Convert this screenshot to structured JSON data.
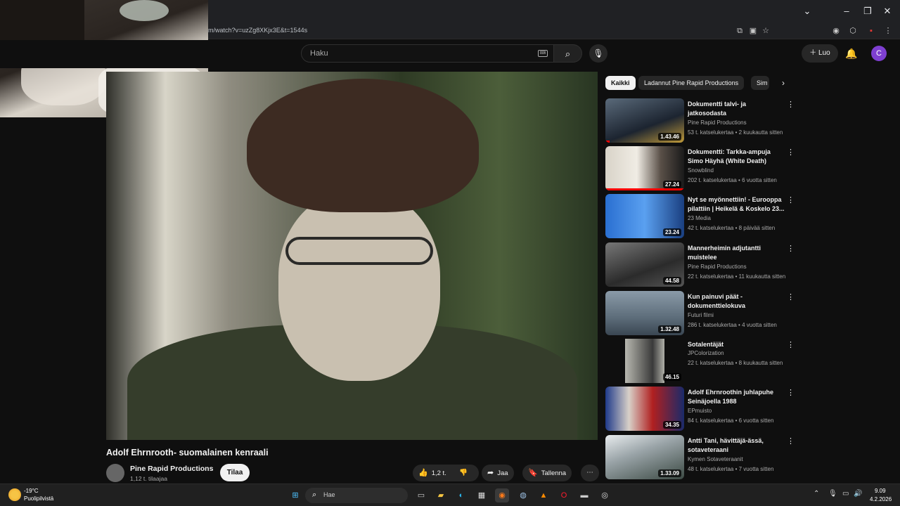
{
  "browser": {
    "url": "m/watch?v=uzZg8XKjx3E&t=1544s",
    "window_controls": [
      "chevron-down-icon",
      "minimize-icon",
      "restore-icon",
      "close-icon"
    ]
  },
  "header": {
    "search_placeholder": "Haku",
    "create_label": "Luo",
    "avatar_initial": "C",
    "accent_color": "#7e3fd1"
  },
  "video": {
    "title": "Adolf Ehrnrooth- suomalainen kenraali",
    "channel": "Pine Rapid Productions",
    "subscribers": "1,12 t. tilaajaa",
    "subscribe_label": "Tilaa",
    "likes": "1,2 t.",
    "share_label": "Jaa",
    "save_label": "Tallenna"
  },
  "chips": [
    "Kaikki",
    "Ladannut Pine Rapid Productions",
    "Sim"
  ],
  "recommendations": [
    {
      "title": "Dokumentti talvi- ja jatkosodasta",
      "channel": "Pine Rapid Productions",
      "meta": "53 t. katselukertaa • 2 kuukautta sitten",
      "duration": "1.43.46",
      "progress": 0.05
    },
    {
      "title": "Dokumentti: Tarkka-ampuja Simo Häyhä (White Death)",
      "channel": "Snowblind",
      "meta": "202 t. katselukertaa • 6 vuotta sitten",
      "duration": "27.24",
      "progress": 1.0
    },
    {
      "title": "Nyt se myönnettiin! - Eurooppa pilattiin | Heikelä & Koskelo 23...",
      "channel": "23 Media",
      "meta": "42 t. katselukertaa • 8 päivää sitten",
      "duration": "23.24",
      "progress": 0
    },
    {
      "title": "Mannerheimin adjutantti muistelee",
      "channel": "Pine Rapid Productions",
      "meta": "22 t. katselukertaa • 11 kuukautta sitten",
      "duration": "44.58",
      "progress": 0
    },
    {
      "title": "Kun painuvi päät - dokumenttielokuva",
      "channel": "Futuri filmi",
      "meta": "286 t. katselukertaa • 4 vuotta sitten",
      "duration": "1.32.48",
      "progress": 0
    },
    {
      "title": "Sotalentäjät",
      "channel": "JPColorization",
      "meta": "22 t. katselukertaa • 8 kuukautta sitten",
      "duration": "46.15",
      "progress": 0
    },
    {
      "title": "Adolf Ehrnroothin juhlapuhe Seinäjoella 1988",
      "channel": "EPmuisto",
      "meta": "84 t. katselukertaa • 6 vuotta sitten",
      "duration": "34.35",
      "progress": 0
    },
    {
      "title": "Antti Tani, hävittäjä-ässä, sotaveteraani",
      "channel": "Kymen Sotaveteraanit",
      "meta": "48 t. katselukertaa • 7 vuotta sitten",
      "duration": "1.33.09",
      "progress": 0
    }
  ],
  "taskbar": {
    "temperature": "-19°C",
    "weather": "Puolipilvistä",
    "search_placeholder": "Hae",
    "time": "9.09",
    "date": "4.2.2026"
  }
}
